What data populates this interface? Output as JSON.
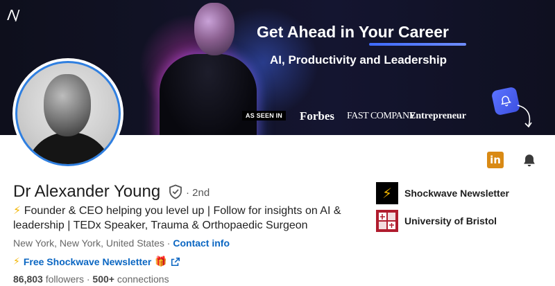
{
  "banner": {
    "logo_text": "Λ/",
    "headline": "Get Ahead in Your Career",
    "subline": "AI, Productivity and Leadership",
    "seen_in": "AS SEEN IN",
    "press": [
      "Forbes",
      "FAST COMPANY",
      "Entrepreneur"
    ]
  },
  "actions": {
    "linkedin_label": "in"
  },
  "profile": {
    "name": "Dr Alexander Young",
    "degree": "· 2nd",
    "headline_icon": "⚡",
    "headline": "Founder & CEO helping you level up | Follow for insights on AI & leadership | TEDx Speaker, Trauma & Orthopaedic Surgeon",
    "location": "New York, New York, United States",
    "separator": "·",
    "contact_info": "Contact info",
    "newsletter_icon": "⚡",
    "newsletter_link": "Free Shockwave Newsletter",
    "gift_icon": "🎁",
    "followers_count": "86,803",
    "followers_label": "followers",
    "connections_count": "500+",
    "connections_label": "connections"
  },
  "side": {
    "items": [
      {
        "label": "Shockwave Newsletter",
        "icon": "⚡"
      },
      {
        "label": "University of Bristol"
      }
    ]
  },
  "colors": {
    "link": "#0a66c2",
    "avatar_ring": "#2f7fe0",
    "linkedin_badge": "#d98a15",
    "bell_badge": "#5b73ff"
  }
}
